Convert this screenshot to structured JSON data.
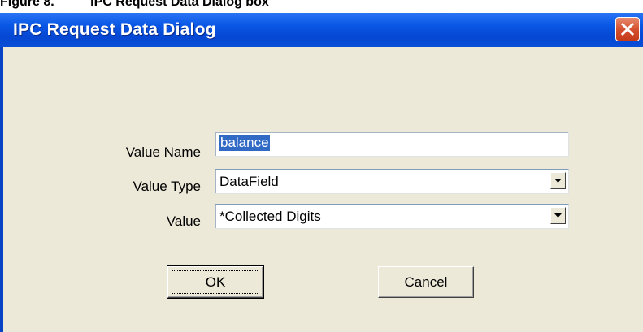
{
  "caption": {
    "label": "Figure 8.",
    "text": "IPC Request Data Dialog box"
  },
  "dialog": {
    "title": "IPC Request Data Dialog",
    "colors": {
      "titlebar": "#0a58e6",
      "client": "#ece9d8",
      "selection": "#316ac5",
      "close": "#d5512f"
    }
  },
  "form": {
    "value_name": {
      "label": "Value Name",
      "value": "balance"
    },
    "value_type": {
      "label": "Value Type",
      "value": "DataField"
    },
    "value": {
      "label": "Value",
      "value": "*Collected Digits"
    }
  },
  "buttons": {
    "ok": "OK",
    "cancel": "Cancel"
  },
  "icons": {
    "close": "close-icon",
    "dropdown": "dropdown-arrow-icon"
  }
}
